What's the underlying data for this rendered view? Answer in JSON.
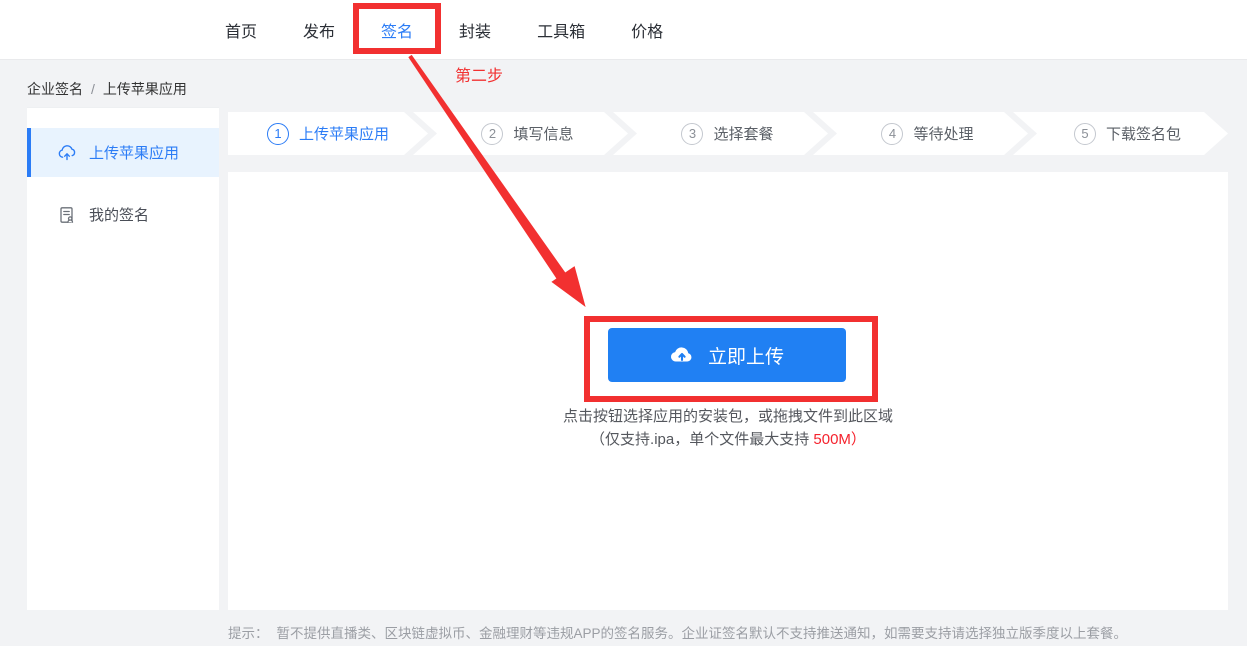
{
  "nav": {
    "items": [
      {
        "label": "首页",
        "active": false
      },
      {
        "label": "发布",
        "active": false
      },
      {
        "label": "签名",
        "active": true
      },
      {
        "label": "封装",
        "active": false
      },
      {
        "label": "工具箱",
        "active": false
      },
      {
        "label": "价格",
        "active": false
      }
    ]
  },
  "breadcrumb": {
    "items": [
      "企业签名",
      "上传苹果应用"
    ],
    "separator": "/"
  },
  "sidebar": {
    "items": [
      {
        "label": "上传苹果应用",
        "icon": "cloud-upload-icon",
        "active": true
      },
      {
        "label": "我的签名",
        "icon": "signature-doc-icon",
        "active": false
      }
    ]
  },
  "steps": [
    {
      "num": "1",
      "label": "上传苹果应用",
      "active": true
    },
    {
      "num": "2",
      "label": "填写信息",
      "active": false
    },
    {
      "num": "3",
      "label": "选择套餐",
      "active": false
    },
    {
      "num": "4",
      "label": "等待处理",
      "active": false
    },
    {
      "num": "5",
      "label": "下载签名包",
      "active": false
    }
  ],
  "upload": {
    "button_label": "立即上传",
    "hint_line1": "点击按钮选择应用的安装包，或拖拽文件到此区域",
    "hint_line2_prefix": "（仅支持.ipa，单个文件最大支持 ",
    "hint_line2_highlight": "500M）"
  },
  "footer": {
    "tip_label": "提示：",
    "tip_text": "暂不提供直播类、区块链虚拟币、金融理财等违规APP的签名服务。企业证签名默认不支持推送通知，如需要支持请选择独立版季度以上套餐。"
  },
  "annotation": {
    "step_label": "第二步"
  },
  "colors": {
    "accent_blue": "#2b7cf6",
    "button_blue": "#2080f3",
    "annotation_red": "#f23030",
    "highlight_red": "#f5222d"
  }
}
